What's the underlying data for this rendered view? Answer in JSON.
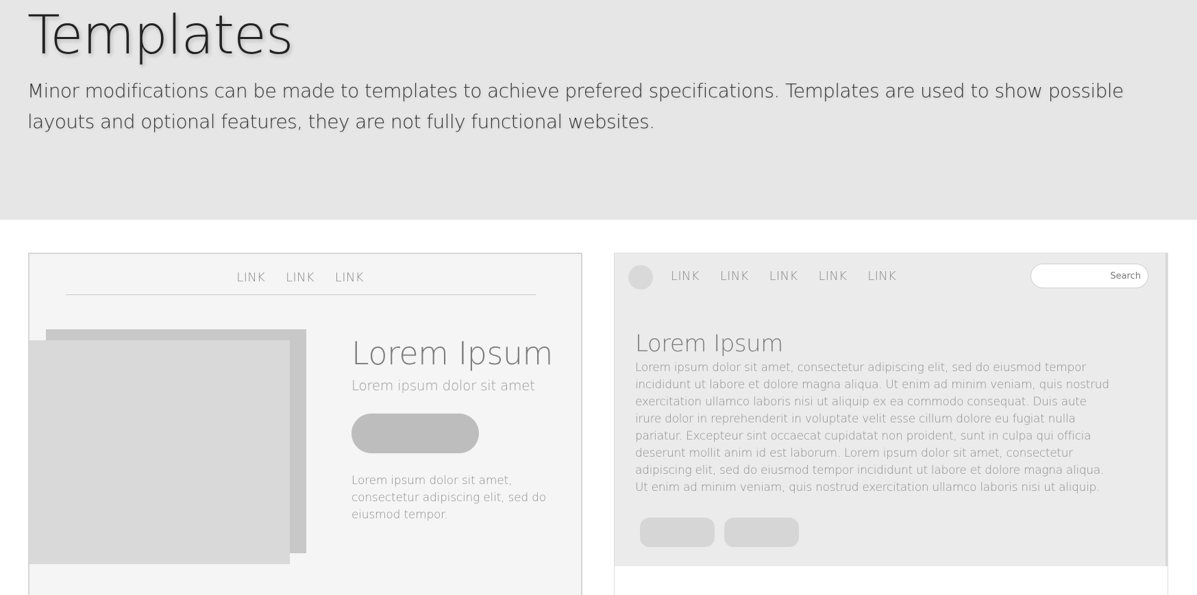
{
  "header": {
    "title": "Templates",
    "description": "Minor modifications can be made to templates to achieve prefered specifications. Templates are used to show possible layouts and optional features, they are not fully functional websites."
  },
  "cards": [
    {
      "nav_links": [
        "LINK",
        "LINK",
        "LINK"
      ],
      "heading": "Lorem Ipsum",
      "subheading": "Lorem ipsum dolor sit amet",
      "body": "Lorem ipsum dolor sit amet, consectetur adipiscing elit, sed do eiusmod tempor."
    },
    {
      "nav_links": [
        "LINK",
        "LINK",
        "LINK",
        "LINK",
        "LINK"
      ],
      "search_placeholder": "Search",
      "heading": "Lorem Ipsum",
      "body": "Lorem ipsum dolor sit amet, consectetur adipiscing elit, sed do eiusmod tempor incididunt ut labore et dolore magna aliqua. Ut enim ad minim veniam, quis nostrud exercitation ullamco laboris nisi ut aliquip ex ea commodo consequat. Duis aute irure dolor in reprehenderit in voluptate velit esse cillum dolore eu fugiat nulla pariatur. Excepteur sint occaecat cupidatat non proident, sunt in culpa qui officia deserunt mollit anim id est laborum. Lorem ipsum dolor sit amet, consectetur adipiscing elit, sed do eiusmod tempor incididunt ut labore et dolore magna aliqua. Ut enim ad minim veniam, quis nostrud exercitation ullamco laboris nisi ut aliquip."
    }
  ],
  "colors": {
    "hero_background": "#e6e6e6",
    "card_background": "#f5f5f5",
    "placeholder_gray": "#bdbdbd"
  }
}
